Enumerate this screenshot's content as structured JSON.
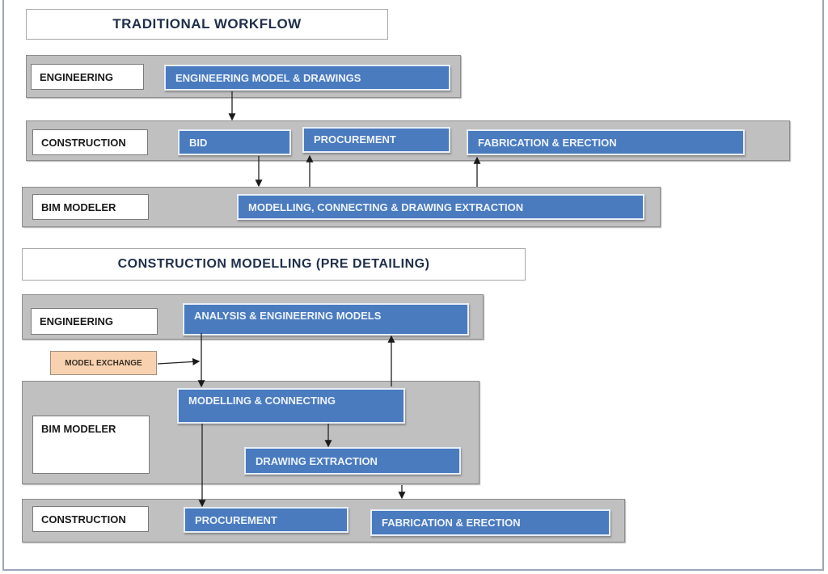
{
  "traditional": {
    "title": "TRADITIONAL WORKFLOW",
    "rows": {
      "engineering": {
        "label": "ENGINEERING",
        "steps": [
          "ENGINEERING MODEL & DRAWINGS"
        ]
      },
      "construction": {
        "label": "CONSTRUCTION",
        "steps": [
          "BID",
          "PROCUREMENT",
          "FABRICATION & ERECTION"
        ]
      },
      "bim": {
        "label": "BIM MODELER",
        "steps": [
          "MODELLING, CONNECTING & DRAWING EXTRACTION"
        ]
      }
    },
    "flows": [
      "ENGINEERING MODEL & DRAWINGS -> CONSTRUCTION",
      "BID -> MODELLING, CONNECTING & DRAWING EXTRACTION",
      "MODELLING, CONNECTING & DRAWING EXTRACTION -> PROCUREMENT",
      "MODELLING, CONNECTING & DRAWING EXTRACTION -> FABRICATION & ERECTION"
    ]
  },
  "pre_detailing": {
    "title": "CONSTRUCTION MODELLING (PRE DETAILING)",
    "rows": {
      "engineering": {
        "label": "ENGINEERING",
        "steps": [
          "ANALYSIS & ENGINEERING MODELS"
        ]
      },
      "bim": {
        "label": "BIM MODELER",
        "steps": [
          "MODELLING & CONNECTING",
          "DRAWING EXTRACTION"
        ]
      },
      "construction": {
        "label": "CONSTRUCTION",
        "steps": [
          "PROCUREMENT",
          "FABRICATION & ERECTION"
        ]
      }
    },
    "note": "MODEL EXCHANGE",
    "flows": [
      "ANALYSIS & ENGINEERING MODELS -> MODELLING & CONNECTING",
      "MODEL EXCHANGE -> ANALYSIS & ENGINEERING MODELS flow",
      "MODELLING & CONNECTING -> ANALYSIS & ENGINEERING MODELS",
      "MODELLING & CONNECTING -> DRAWING EXTRACTION",
      "MODELLING & CONNECTING -> PROCUREMENT",
      "DRAWING EXTRACTION -> FABRICATION & ERECTION"
    ]
  },
  "colors": {
    "step_fill": "#4a7bbf",
    "band_fill": "#c0c0c0",
    "note_fill": "#f8d2b0",
    "title_text": "#1f2e4a"
  }
}
